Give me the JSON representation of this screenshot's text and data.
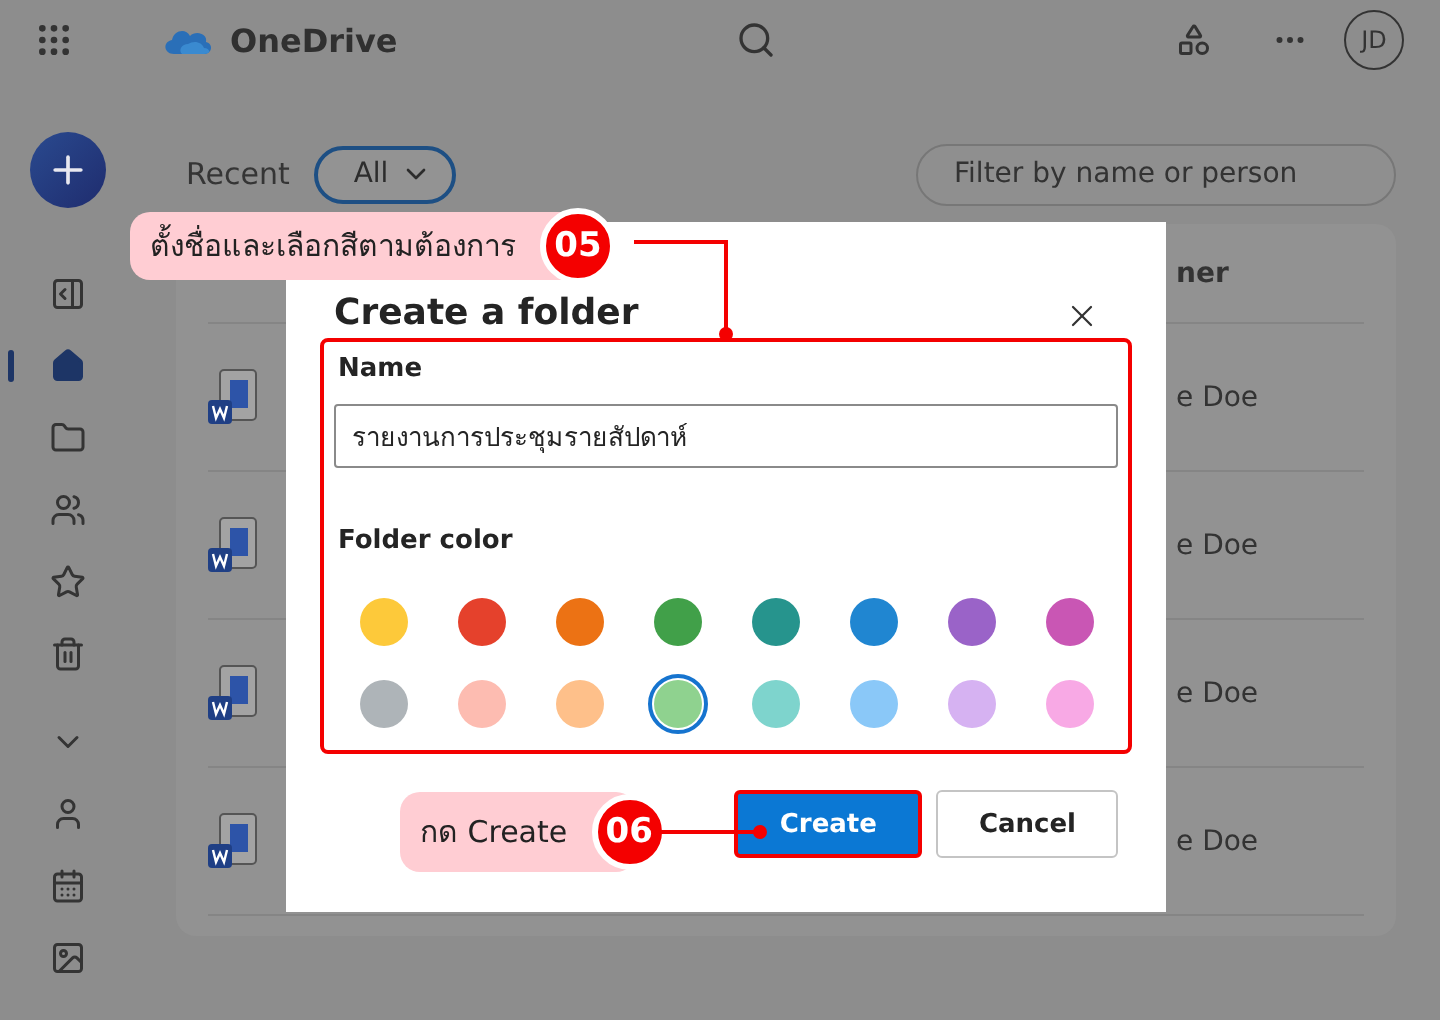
{
  "app": {
    "title": "OneDrive",
    "avatar": "JD"
  },
  "sidebar": {
    "items": [
      {
        "kind": "panel",
        "selected": false
      },
      {
        "kind": "home",
        "selected": true
      },
      {
        "kind": "folder",
        "selected": false
      },
      {
        "kind": "people",
        "selected": false
      },
      {
        "kind": "star",
        "selected": false
      },
      {
        "kind": "trash",
        "selected": false
      },
      {
        "kind": "chevron",
        "selected": false
      },
      {
        "kind": "person",
        "selected": false
      },
      {
        "kind": "calendar",
        "selected": false
      },
      {
        "kind": "image",
        "selected": false
      }
    ]
  },
  "toolbar": {
    "section": "Recent",
    "filter": "All",
    "search": {
      "placeholder": "Filter by name or person"
    }
  },
  "table": {
    "columns": [
      {
        "label": "ner"
      }
    ],
    "rows": [
      {
        "owner": "e Doe"
      },
      {
        "owner": "e Doe"
      },
      {
        "owner": "e Doe"
      },
      {
        "owner": "e Doe"
      }
    ]
  },
  "dialog": {
    "title": "Create a folder",
    "name_label": "Name",
    "name_value": "รายงานการประชุมรายสัปดาห์",
    "color_label": "Folder color",
    "colors": [
      {
        "color": "#fdc93a",
        "selected": false
      },
      {
        "color": "#e5412c",
        "selected": false
      },
      {
        "color": "#ec7214",
        "selected": false
      },
      {
        "color": "#41a049",
        "selected": false
      },
      {
        "color": "#26948d",
        "selected": false
      },
      {
        "color": "#2086d1",
        "selected": false
      },
      {
        "color": "#9a63c8",
        "selected": false
      },
      {
        "color": "#c956b4",
        "selected": false
      },
      {
        "color": "#aeb4b8",
        "selected": false
      },
      {
        "color": "#fdbcb1",
        "selected": false
      },
      {
        "color": "#fec08a",
        "selected": false
      },
      {
        "color": "#8fd28f",
        "selected": true
      },
      {
        "color": "#7ed4cd",
        "selected": false
      },
      {
        "color": "#8ac8f8",
        "selected": false
      },
      {
        "color": "#d6b2f2",
        "selected": false
      },
      {
        "color": "#f8a9e5",
        "selected": false
      }
    ],
    "buttons": [
      {
        "label": "Create",
        "kind": "primary"
      },
      {
        "label": "Cancel",
        "kind": "secondary"
      }
    ]
  },
  "callouts": [
    {
      "text": "ตั้งชื่อและเลือกสีตามต้องการ",
      "number": "05"
    },
    {
      "text": "กด Create",
      "number": "06"
    }
  ]
}
